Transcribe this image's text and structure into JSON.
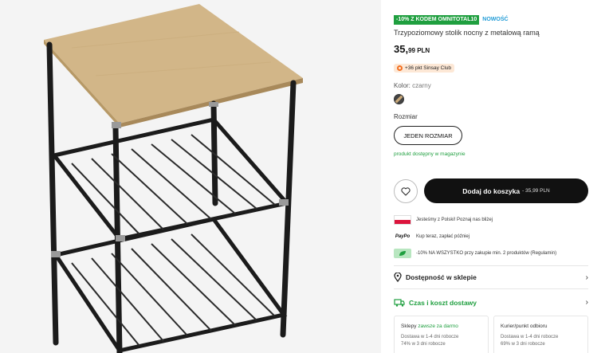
{
  "product": {
    "badge_promo": "-10% Z KODEM OMNITOTAL10",
    "badge_new": "NOWOŚĆ",
    "title": "Trzypoziomowy stolik nocny z metalową ramą",
    "price_main": "35,",
    "price_cents": "99 PLN",
    "club_text": "+36 pkt Sinsay Club",
    "color_label": "Kolor:",
    "color_value": "czarny",
    "size_label": "Rozmiar",
    "size_option": "JEDEN ROZMIAR",
    "availability": "produkt dostępny w magazynie"
  },
  "actions": {
    "add_to_cart": "Dodaj do koszyka",
    "add_to_cart_price": "- 35,99 PLN"
  },
  "info": {
    "poland": "Jesteśmy z Polski! Poznaj nas bliżej",
    "paypo_logo": "PayPo",
    "paypo": "Kup teraz, zapłać później",
    "discount": "-10% NA WSZYSTKO przy zakupie min. 2 produktów (Regulamin)"
  },
  "links": {
    "store_availability": "Dostępność w sklepie",
    "delivery": "Czas i koszt dostawy"
  },
  "shipping": {
    "stores_title": "Sklepy",
    "stores_free": "zawsze za darmo",
    "stores_line1": "Dostawa w 1-4 dni robocze",
    "stores_line2": "74% w 3 dni robocze",
    "courier_title": "Kurier/punkt odbioru",
    "courier_line1": "Dostawa w 1-4 dni robocze",
    "courier_line2": "69% w 3 dni robocze"
  },
  "colors": {
    "accent_green": "#1f9f3f",
    "new_blue": "#1f9bd6",
    "button_dark": "#111111",
    "club_bg": "#fde8d6"
  },
  "icons": {
    "favorite": "heart-icon",
    "store": "location-pin-icon",
    "delivery": "truck-icon",
    "more": "chevron-right-icon"
  }
}
